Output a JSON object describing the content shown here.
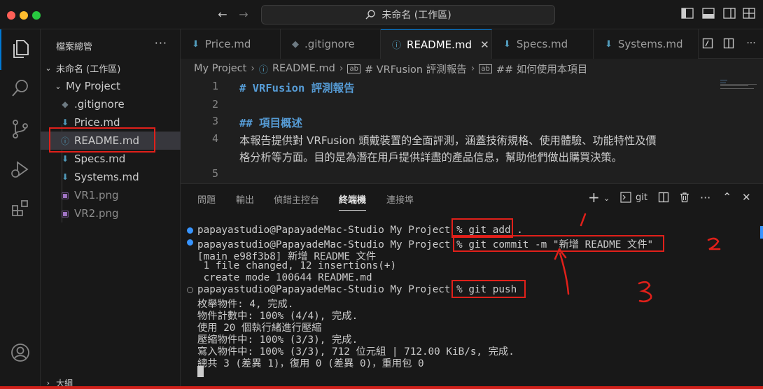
{
  "window": {
    "title": "未命名 (工作區)",
    "traffic_colors": [
      "#ff5f57",
      "#febc2e",
      "#28c840"
    ]
  },
  "sidebar": {
    "title": "檔案總管",
    "more": "···",
    "workspace": "未命名 (工作區)",
    "folder": "My Project",
    "files": [
      {
        "name": ".gitignore",
        "icon": "git-diamond-icon"
      },
      {
        "name": "Price.md",
        "icon": "markdown-arrow-icon"
      },
      {
        "name": "README.md",
        "icon": "info-circle-icon"
      },
      {
        "name": "Specs.md",
        "icon": "markdown-arrow-icon"
      },
      {
        "name": "Systems.md",
        "icon": "markdown-arrow-icon"
      },
      {
        "name": "VR1.png",
        "icon": "image-icon"
      },
      {
        "name": "VR2.png",
        "icon": "image-icon"
      }
    ],
    "outline": "大綱"
  },
  "tabs": [
    {
      "label": "Price.md",
      "active": false
    },
    {
      "label": ".gitignore",
      "active": false
    },
    {
      "label": "README.md",
      "active": true
    },
    {
      "label": "Specs.md",
      "active": false
    },
    {
      "label": "Systems.md",
      "active": false
    }
  ],
  "breadcrumb": {
    "items": [
      "My Project",
      "README.md",
      "# VRFusion 評測報告",
      "## 如何使用本項目"
    ]
  },
  "editor": {
    "lines": [
      {
        "num": "1",
        "text": "# VRFusion 評測報告"
      },
      {
        "num": "2",
        "text": ""
      },
      {
        "num": "3",
        "text": "## 項目概述"
      },
      {
        "num": "4",
        "text": "本報告提供對 VRFusion 頭戴裝置的全面評測，涵蓋技術規格、使用體驗、功能特性及價"
      },
      {
        "num": "",
        "text": "格分析等方面。目的是為潛在用戶提供詳盡的產品信息，幫助他們做出購買決策。"
      },
      {
        "num": "5",
        "text": ""
      }
    ]
  },
  "panel": {
    "tabs": [
      "問題",
      "輸出",
      "偵錯主控台",
      "終端機",
      "連接埠"
    ],
    "active_tab": "終端機",
    "terminal_name": "git",
    "lines": [
      {
        "prompt": "papayastudio@PapayadeMac-Studio My Project % ",
        "cmd": "git add .",
        "dot": "filled"
      },
      {
        "prompt": "papayastudio@PapayadeMac-Studio My Project % ",
        "cmd": "git commit -m \"新增 README 文件\"",
        "dot": "filled"
      },
      {
        "text": "[main e98f3b8] 新增 README 文件"
      },
      {
        "text": " 1 file changed, 12 insertions(+)"
      },
      {
        "text": " create mode 100644 README.md"
      },
      {
        "prompt": "papayastudio@PapayadeMac-Studio My Project % ",
        "cmd": "git push",
        "dot": "hollow"
      },
      {
        "text": "枚舉物件: 4, 完成."
      },
      {
        "text": "物件計數中: 100% (4/4), 完成."
      },
      {
        "text": "使用 20 個執行緒進行壓縮"
      },
      {
        "text": "壓縮物件中: 100% (3/3), 完成."
      },
      {
        "text": "寫入物件中: 100% (3/3), 712 位元組 | 712.00 KiB/s, 完成."
      },
      {
        "text": "總共 3 (差異 1)，復用 0 (差異 0)，重用包 0"
      }
    ]
  },
  "annotations": {
    "color": "#e0201a"
  }
}
